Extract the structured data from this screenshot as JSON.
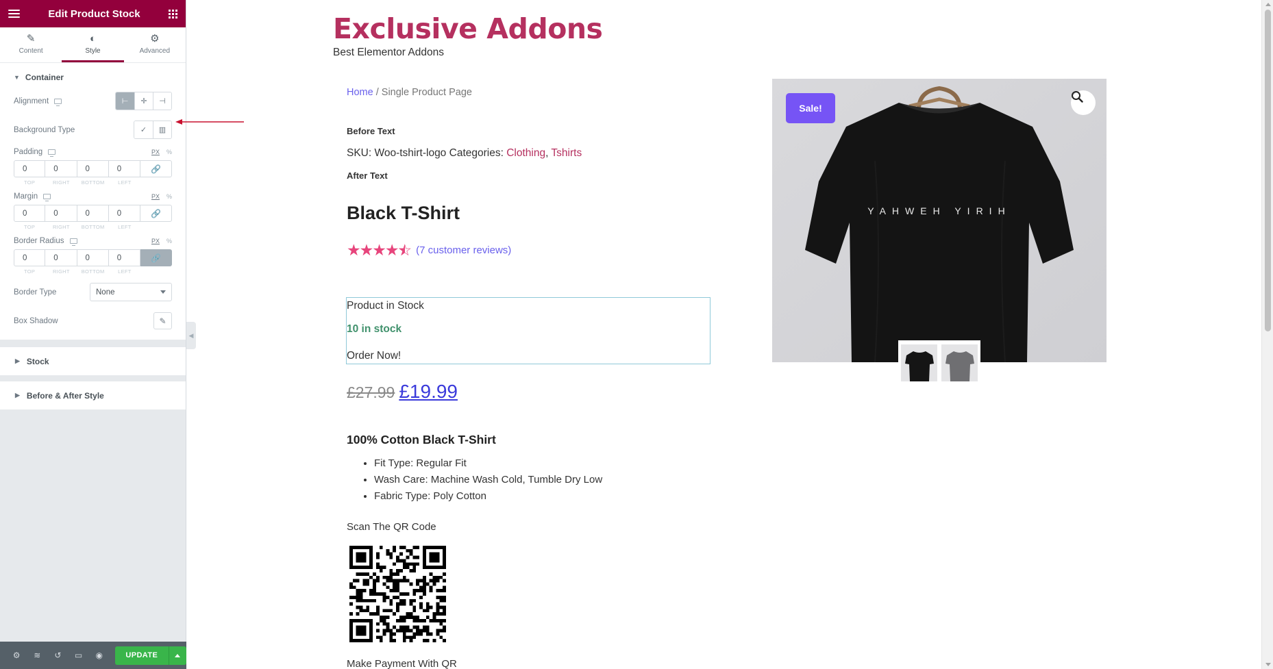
{
  "panel": {
    "title": "Edit Product Stock",
    "tabs": [
      {
        "label": "Content",
        "icon": "pencil-icon"
      },
      {
        "label": "Style",
        "icon": "half-circle-icon"
      },
      {
        "label": "Advanced",
        "icon": "gear-icon"
      }
    ],
    "container": {
      "heading": "Container",
      "alignment_label": "Alignment",
      "alignment_selected": "left",
      "background_type_label": "Background Type",
      "padding": {
        "label": "Padding",
        "unit_px": "PX",
        "unit_pct": "%",
        "values": [
          "0",
          "0",
          "0",
          "0"
        ],
        "subs": [
          "TOP",
          "RIGHT",
          "BOTTOM",
          "LEFT"
        ]
      },
      "margin": {
        "label": "Margin",
        "unit_px": "PX",
        "unit_pct": "%",
        "values": [
          "0",
          "0",
          "0",
          "0"
        ],
        "subs": [
          "TOP",
          "RIGHT",
          "BOTTOM",
          "LEFT"
        ]
      },
      "border_radius": {
        "label": "Border Radius",
        "unit_px": "PX",
        "unit_pct": "%",
        "values": [
          "0",
          "0",
          "0",
          "0"
        ],
        "subs": [
          "TOP",
          "RIGHT",
          "BOTTOM",
          "LEFT"
        ],
        "linked": true
      },
      "border_type": {
        "label": "Border Type",
        "value": "None"
      },
      "box_shadow_label": "Box Shadow"
    },
    "sections": [
      {
        "label": "Stock"
      },
      {
        "label": "Before & After Style"
      }
    ],
    "footer": {
      "update_label": "UPDATE"
    },
    "colors": {
      "brand": "#93003c",
      "update": "#39b54a",
      "footer": "#556068"
    }
  },
  "preview": {
    "site_title": "Exclusive Addons",
    "site_tagline": "Best Elementor Addons",
    "breadcrumb": {
      "home": "Home",
      "separator": " / ",
      "current": "Single Product Page"
    },
    "before_text": "Before Text",
    "meta": {
      "sku_label": "SKU:",
      "sku": "Woo-tshirt-logo",
      "categories_label": "Categories:",
      "cat1": "Clothing",
      "sep": ", ",
      "cat2": "Tshirts"
    },
    "after_text": "After Text",
    "product_title": "Black T-Shirt",
    "rating": {
      "value": 4.5,
      "out_of": 5,
      "reviews": "(7 customer reviews)"
    },
    "stock": {
      "label": "Product in Stock",
      "status": "10 in stock",
      "cta": "Order Now!"
    },
    "price": {
      "old": "£27.99",
      "new": "£19.99"
    },
    "description": {
      "title": "100% Cotton Black T-Shirt",
      "items": [
        "Fit Type: Regular Fit",
        "Wash Care: Machine Wash Cold, Tumble Dry Low",
        "Fabric Type: Poly Cotton"
      ]
    },
    "qr_label": "Scan The QR Code",
    "payment_label": "Make Payment With QR",
    "gallery": {
      "sale_badge": "Sale!",
      "shirt_print": "YAHWEH YIRIH"
    },
    "colors": {
      "title": "#b5305f",
      "link": "#6960ec",
      "sale": "#7654f5",
      "stock": "#40916c",
      "price": "#3a3adb"
    }
  }
}
